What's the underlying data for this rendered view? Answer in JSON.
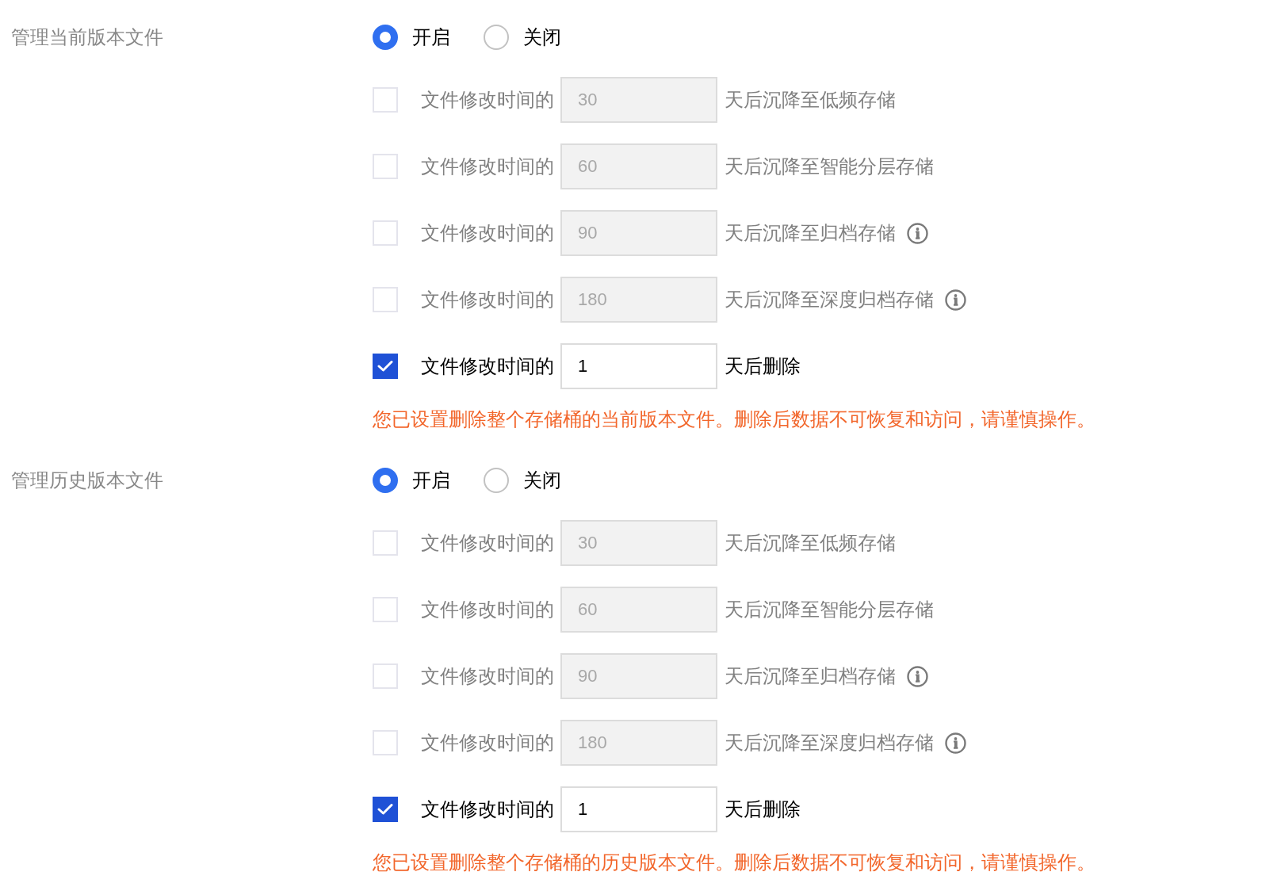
{
  "sections": [
    {
      "label": "管理当前版本文件",
      "radios": [
        {
          "label": "开启",
          "selected": true
        },
        {
          "label": "关闭",
          "selected": false
        }
      ],
      "rules": [
        {
          "checked": false,
          "prefix": "文件修改时间的",
          "value": "30",
          "suffix": "天后沉降至低频存储",
          "info": false
        },
        {
          "checked": false,
          "prefix": "文件修改时间的",
          "value": "60",
          "suffix": "天后沉降至智能分层存储",
          "info": false
        },
        {
          "checked": false,
          "prefix": "文件修改时间的",
          "value": "90",
          "suffix": "天后沉降至归档存储",
          "info": true
        },
        {
          "checked": false,
          "prefix": "文件修改时间的",
          "value": "180",
          "suffix": "天后沉降至深度归档存储",
          "info": true
        },
        {
          "checked": true,
          "prefix": "文件修改时间的",
          "value": "1",
          "suffix": "天后删除",
          "info": false
        }
      ],
      "warning": "您已设置删除整个存储桶的当前版本文件。删除后数据不可恢复和访问，请谨慎操作。"
    },
    {
      "label": "管理历史版本文件",
      "radios": [
        {
          "label": "开启",
          "selected": true
        },
        {
          "label": "关闭",
          "selected": false
        }
      ],
      "rules": [
        {
          "checked": false,
          "prefix": "文件修改时间的",
          "value": "30",
          "suffix": "天后沉降至低频存储",
          "info": false
        },
        {
          "checked": false,
          "prefix": "文件修改时间的",
          "value": "60",
          "suffix": "天后沉降至智能分层存储",
          "info": false
        },
        {
          "checked": false,
          "prefix": "文件修改时间的",
          "value": "90",
          "suffix": "天后沉降至归档存储",
          "info": true
        },
        {
          "checked": false,
          "prefix": "文件修改时间的",
          "value": "180",
          "suffix": "天后沉降至深度归档存储",
          "info": true
        },
        {
          "checked": true,
          "prefix": "文件修改时间的",
          "value": "1",
          "suffix": "天后删除",
          "info": false
        }
      ],
      "warning": "您已设置删除整个存储桶的历史版本文件。删除后数据不可恢复和访问，请谨慎操作。"
    }
  ]
}
